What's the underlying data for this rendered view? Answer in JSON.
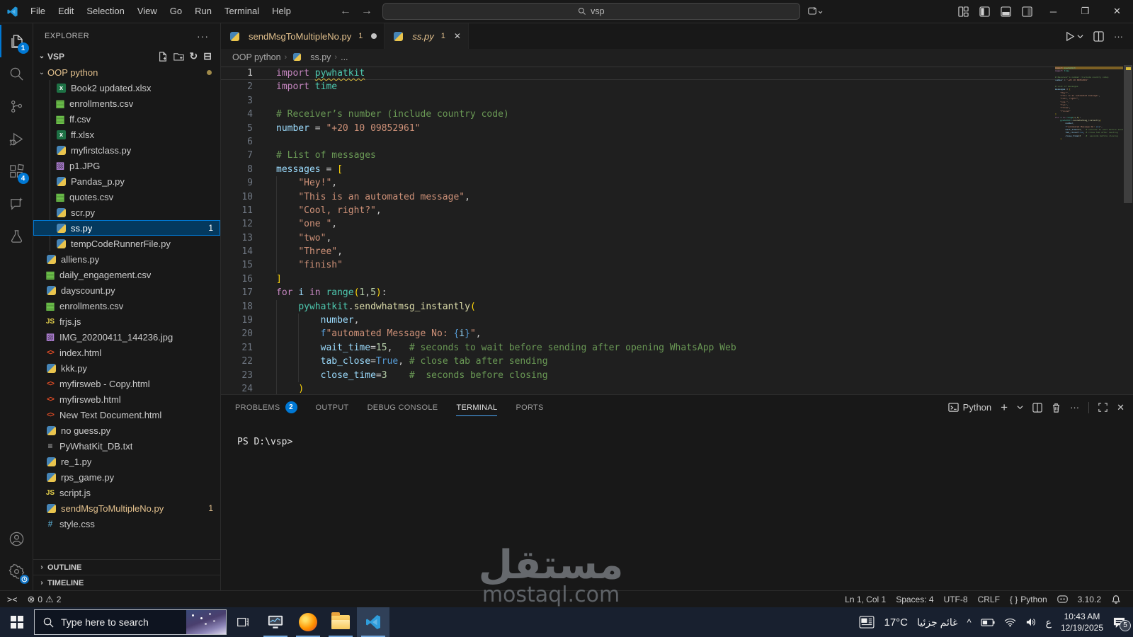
{
  "titlebar": {
    "menus": [
      "File",
      "Edit",
      "Selection",
      "View",
      "Go",
      "Run",
      "Terminal",
      "Help"
    ],
    "back": "←",
    "forward": "→",
    "search_value": "vsp",
    "window_controls": {
      "minimize": "─",
      "restore": "❐",
      "close": "✕"
    }
  },
  "activity": {
    "explorer_badge": "1",
    "extensions_badge": "4"
  },
  "explorer": {
    "header": "EXPLORER",
    "header_more": "···",
    "root_label": "VSP",
    "items": [
      {
        "label": "OOP python",
        "type": "folder",
        "level": 1,
        "cls": "modified",
        "chevron": true,
        "gitdot": true
      },
      {
        "label": "Book2  updated.xlsx",
        "type": "xlsx",
        "level": 2
      },
      {
        "label": "enrollments.csv",
        "type": "csv",
        "level": 2
      },
      {
        "label": "ff.csv",
        "type": "csv",
        "level": 2
      },
      {
        "label": "ff.xlsx",
        "type": "xlsx",
        "level": 2
      },
      {
        "label": "myfirstclass.py",
        "type": "py",
        "level": 2
      },
      {
        "label": "p1.JPG",
        "type": "img",
        "level": 2
      },
      {
        "label": "Pandas_p.py",
        "type": "py",
        "level": 2
      },
      {
        "label": "quotes.csv",
        "type": "csv",
        "level": 2
      },
      {
        "label": "scr.py",
        "type": "py",
        "level": 2
      },
      {
        "label": "ss.py",
        "type": "py",
        "level": 2,
        "selected": true,
        "badge": "1"
      },
      {
        "label": "tempCodeRunnerFile.py",
        "type": "py",
        "level": 2
      },
      {
        "label": "alliens.py",
        "type": "py",
        "level": 1
      },
      {
        "label": "daily_engagement.csv",
        "type": "csv",
        "level": 1
      },
      {
        "label": "dayscount.py",
        "type": "py",
        "level": 1
      },
      {
        "label": "enrollments.csv",
        "type": "csv",
        "level": 1
      },
      {
        "label": "frjs.js",
        "type": "js",
        "level": 1
      },
      {
        "label": "IMG_20200411_144236.jpg",
        "type": "img",
        "level": 1
      },
      {
        "label": "index.html",
        "type": "html",
        "level": 1
      },
      {
        "label": "kkk.py",
        "type": "py",
        "level": 1
      },
      {
        "label": "myfirsweb - Copy.html",
        "type": "html",
        "level": 1
      },
      {
        "label": "myfirsweb.html",
        "type": "html",
        "level": 1
      },
      {
        "label": "New Text Document.html",
        "type": "html",
        "level": 1
      },
      {
        "label": "no guess.py",
        "type": "py",
        "level": 1
      },
      {
        "label": "PyWhatKit_DB.txt",
        "type": "txt",
        "level": 1
      },
      {
        "label": "re_1.py",
        "type": "py",
        "level": 1
      },
      {
        "label": "rps_game.py",
        "type": "py",
        "level": 1
      },
      {
        "label": "script.js",
        "type": "js",
        "level": 1
      },
      {
        "label": "sendMsgToMultipleNo.py",
        "type": "py",
        "level": 1,
        "cls": "modified",
        "badge": "1"
      },
      {
        "label": "style.css",
        "type": "css",
        "level": 1
      }
    ],
    "sections": [
      "OUTLINE",
      "TIMELINE"
    ]
  },
  "tabs": [
    {
      "label": "sendMsgToMultipleNo.py",
      "badge": "1",
      "dot": true
    },
    {
      "label": "ss.py",
      "badge": "1",
      "active": true,
      "preview": true,
      "close": "✕"
    }
  ],
  "breadcrumb": {
    "crumbs": [
      "OOP python",
      "ss.py",
      "..."
    ]
  },
  "editor": {
    "lines": [
      {
        "n": 1,
        "cur": true,
        "hl": true,
        "t": [
          [
            "import",
            "kw"
          ],
          [
            " ",
            ""
          ],
          [
            "pywhatkit",
            "cls sq"
          ]
        ]
      },
      {
        "n": 2,
        "t": [
          [
            "import",
            "kw"
          ],
          [
            " ",
            ""
          ],
          [
            "time",
            "cls"
          ]
        ]
      },
      {
        "n": 3,
        "t": []
      },
      {
        "n": 4,
        "t": [
          [
            "# Receiver’s number (include country code)",
            "cmt"
          ]
        ]
      },
      {
        "n": 5,
        "t": [
          [
            "number",
            "var"
          ],
          [
            " = ",
            ""
          ],
          [
            "\"+20 10 09852961\"",
            "str"
          ]
        ]
      },
      {
        "n": 6,
        "t": []
      },
      {
        "n": 7,
        "t": [
          [
            "# List of messages",
            "cmt"
          ]
        ]
      },
      {
        "n": 8,
        "t": [
          [
            "messages",
            "var"
          ],
          [
            " = ",
            ""
          ],
          [
            "[",
            "b1"
          ]
        ]
      },
      {
        "n": 9,
        "g": [
          0
        ],
        "t": [
          [
            "    ",
            ""
          ],
          [
            "\"Hey!\"",
            "str"
          ],
          [
            ",",
            ""
          ]
        ]
      },
      {
        "n": 10,
        "g": [
          0
        ],
        "t": [
          [
            "    ",
            ""
          ],
          [
            "\"This is an automated message\"",
            "str"
          ],
          [
            ",",
            ""
          ]
        ]
      },
      {
        "n": 11,
        "g": [
          0
        ],
        "t": [
          [
            "    ",
            ""
          ],
          [
            "\"Cool, right?\"",
            "str"
          ],
          [
            ",",
            ""
          ]
        ]
      },
      {
        "n": 12,
        "g": [
          0
        ],
        "t": [
          [
            "    ",
            ""
          ],
          [
            "\"one \"",
            "str"
          ],
          [
            ",",
            ""
          ]
        ]
      },
      {
        "n": 13,
        "g": [
          0
        ],
        "t": [
          [
            "    ",
            ""
          ],
          [
            "\"two\"",
            "str"
          ],
          [
            ",",
            ""
          ]
        ]
      },
      {
        "n": 14,
        "g": [
          0
        ],
        "t": [
          [
            "    ",
            ""
          ],
          [
            "\"Three\"",
            "str"
          ],
          [
            ",",
            ""
          ]
        ]
      },
      {
        "n": 15,
        "g": [
          0
        ],
        "t": [
          [
            "    ",
            ""
          ],
          [
            "\"finish\"",
            "str"
          ]
        ]
      },
      {
        "n": 16,
        "t": [
          [
            "]",
            "b1"
          ]
        ]
      },
      {
        "n": 17,
        "t": [
          [
            "for",
            "kw"
          ],
          [
            " ",
            ""
          ],
          [
            "i",
            "var"
          ],
          [
            " ",
            ""
          ],
          [
            "in",
            "kw"
          ],
          [
            " ",
            ""
          ],
          [
            "range",
            "cls"
          ],
          [
            "(",
            "b1"
          ],
          [
            "1",
            "num"
          ],
          [
            ",",
            ""
          ],
          [
            "5",
            "num"
          ],
          [
            ")",
            "b1"
          ],
          [
            ":",
            ""
          ]
        ]
      },
      {
        "n": 18,
        "g": [
          0
        ],
        "t": [
          [
            "    ",
            ""
          ],
          [
            "pywhatkit",
            "cls"
          ],
          [
            ".",
            ""
          ],
          [
            "sendwhatmsg_instantly",
            "fn"
          ],
          [
            "(",
            "b1"
          ]
        ]
      },
      {
        "n": 19,
        "g": [
          0,
          4
        ],
        "t": [
          [
            "        ",
            ""
          ],
          [
            "number",
            "var"
          ],
          [
            ",",
            ""
          ]
        ]
      },
      {
        "n": 20,
        "g": [
          0,
          4
        ],
        "t": [
          [
            "        ",
            ""
          ],
          [
            "f",
            "blue"
          ],
          [
            "\"automated Message No: ",
            "str"
          ],
          [
            "{",
            "blue"
          ],
          [
            "i",
            "var"
          ],
          [
            "}",
            "blue"
          ],
          [
            "\"",
            "str"
          ],
          [
            ",",
            ""
          ]
        ]
      },
      {
        "n": 21,
        "g": [
          0,
          4
        ],
        "t": [
          [
            "        ",
            ""
          ],
          [
            "wait_time",
            "var"
          ],
          [
            "=",
            ""
          ],
          [
            "15",
            "num"
          ],
          [
            ",   ",
            ""
          ],
          [
            "# seconds to wait before sending after opening WhatsApp Web",
            "cmt"
          ]
        ]
      },
      {
        "n": 22,
        "g": [
          0,
          4
        ],
        "t": [
          [
            "        ",
            ""
          ],
          [
            "tab_close",
            "var"
          ],
          [
            "=",
            ""
          ],
          [
            "True",
            "blue"
          ],
          [
            ", ",
            ""
          ],
          [
            "# close tab after sending",
            "cmt"
          ]
        ]
      },
      {
        "n": 23,
        "g": [
          0,
          4
        ],
        "t": [
          [
            "        ",
            ""
          ],
          [
            "close_time",
            "var"
          ],
          [
            "=",
            ""
          ],
          [
            "3",
            "num"
          ],
          [
            "    ",
            ""
          ],
          [
            "#  seconds before closing",
            "cmt"
          ]
        ]
      },
      {
        "n": 24,
        "g": [
          0
        ],
        "t": [
          [
            "    ",
            ""
          ],
          [
            ")",
            "b1"
          ]
        ]
      }
    ]
  },
  "panel": {
    "tabs": [
      {
        "label": "PROBLEMS",
        "badge": "2"
      },
      {
        "label": "OUTPUT"
      },
      {
        "label": "DEBUG CONSOLE"
      },
      {
        "label": "TERMINAL",
        "active": true
      },
      {
        "label": "PORTS"
      }
    ],
    "shell_label": "Python",
    "prompt": "PS D:\\vsp>"
  },
  "statusbar": {
    "errors": "0",
    "warnings": "2",
    "cursor": "Ln 1, Col 1",
    "indent": "Spaces: 4",
    "encoding": "UTF-8",
    "eol": "CRLF",
    "lang_braces": "{ }",
    "language": "Python",
    "interpreter": "3.10.2"
  },
  "taskbar": {
    "search_placeholder": "Type here to search",
    "temp": "17°C",
    "weather": "غائم جزئيا",
    "tray_chevron": "^",
    "lang": "ع",
    "time": "10:43 AM",
    "date": "12/19/2025",
    "notifications": "5"
  },
  "watermark": {
    "line1": "مستقل",
    "line2": "mostaql.com"
  }
}
